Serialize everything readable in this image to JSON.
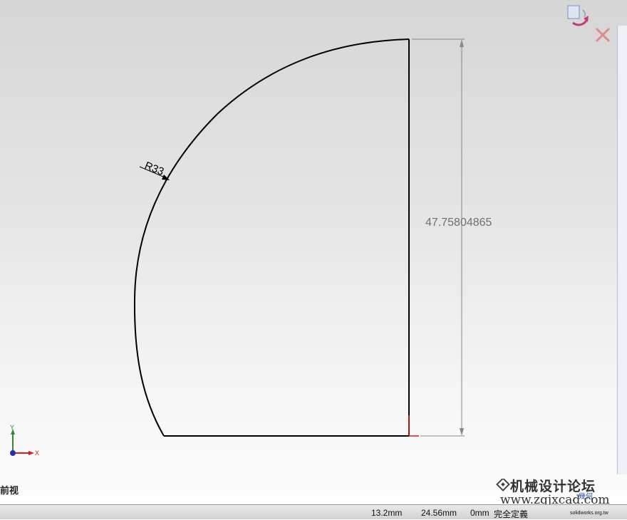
{
  "viewport": {
    "dimension_value": "47.75804865",
    "radius_label": "R33",
    "triad": {
      "x_label": "X",
      "y_label": "Y"
    }
  },
  "view_label": "前视",
  "statusbar": {
    "x": "13.2mm",
    "y": "24.56mm",
    "z": "0mm",
    "status": "完全定義"
  },
  "watermark": {
    "site_name": "机械设计论坛",
    "url": "www.zgjxcad.com",
    "logo_text": "幾何",
    "small_url": "solidworks.org.tw"
  },
  "icons": [
    "confirm-rebuild-icon",
    "cancel-sketch-icon"
  ],
  "colors": {
    "sketch_line": "#000000",
    "dimension": "#777777",
    "triad_x": "#cc2222",
    "triad_y": "#2e8b2e"
  }
}
